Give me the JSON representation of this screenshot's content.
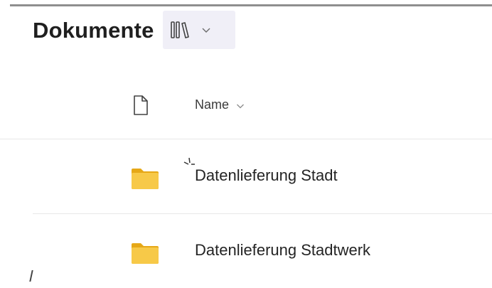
{
  "header": {
    "title": "Dokumente",
    "view_icon": "library-icon",
    "dropdown_icon": "chevron-down-icon"
  },
  "columns": {
    "file_type_icon": "document-icon",
    "name_label": "Name",
    "sort_icon": "chevron-down-icon"
  },
  "rows": [
    {
      "type": "folder",
      "icon": "folder-icon",
      "name": "Datenlieferung Stadt",
      "is_new": true
    },
    {
      "type": "folder",
      "icon": "folder-icon",
      "name": "Datenlieferung Stadtwerk",
      "is_new": false
    }
  ],
  "colors": {
    "folder": "#f4c430",
    "folder_dark": "#e6a817",
    "view_switcher_bg": "#f0eff7",
    "new_marker": "#0f6cbd"
  }
}
